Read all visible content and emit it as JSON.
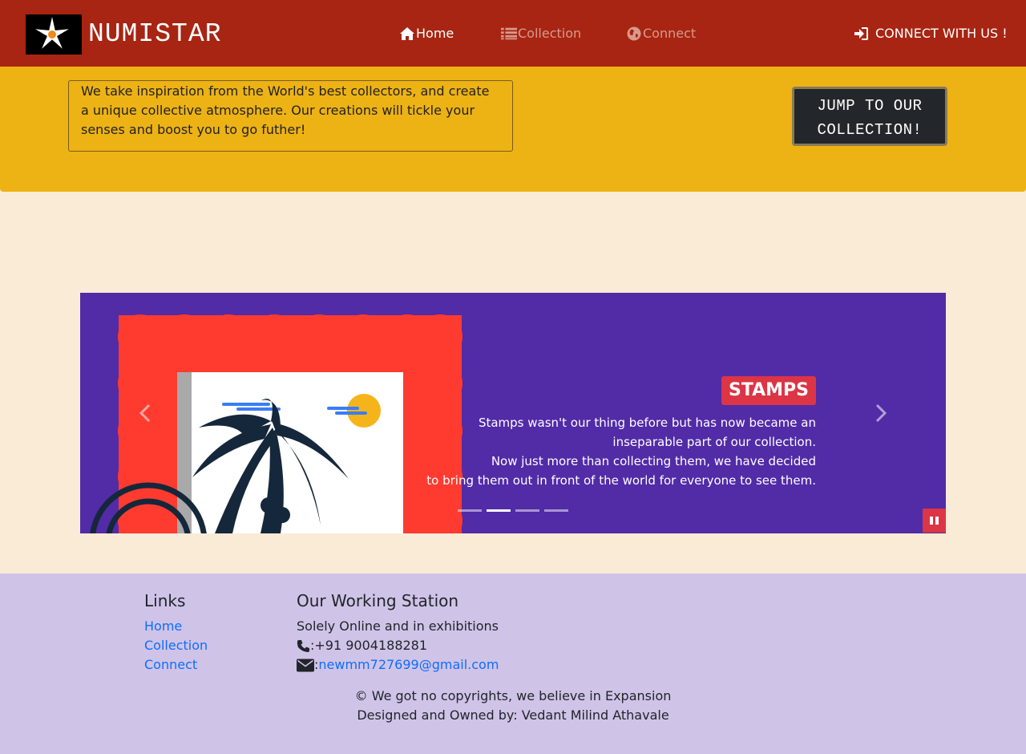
{
  "navbar": {
    "brand": "NUMISTAR",
    "links": [
      {
        "label": "Home",
        "icon": "home-icon",
        "color": "#ffffff"
      },
      {
        "label": "Collection",
        "icon": "list-icon",
        "color": "#d89a8c"
      },
      {
        "label": "Connect",
        "icon": "globe-icon",
        "color": "#d89a8c"
      }
    ],
    "cta": {
      "label": "CONNECT WITH US !",
      "icon": "sign-in-icon"
    },
    "background": "#a72512"
  },
  "hero": {
    "intro": "We take inspiration from the World's best collectors, and create a unique collective atmosphere. Our creations will tickle your senses and boost you to go futher!",
    "jump_button": "JUMP TO OUR COLLECTION!",
    "background": "#edb214"
  },
  "carousel": {
    "title": "STAMPS",
    "body_lines": [
      "Stamps wasn't our thing before but has now became an",
      "inseparable part of our collection.",
      "Now just more than collecting them, we have decided",
      "to bring them out in front of the world for everyone to see them."
    ],
    "slide_count": 4,
    "active_slide": 2,
    "background": "#522ba7"
  },
  "footer": {
    "links_title": "Links",
    "links": [
      "Home",
      "Collection",
      "Connect"
    ],
    "station_title": "Our Working Station",
    "station_text": "Solely Online and in exhibitions",
    "phone": ":+91 9004188281",
    "email_prefix": ":",
    "email": "newmm727699@gmail.com",
    "copyright": "© We got no copyrights, we believe in Expansion",
    "owner": "Designed and Owned by: Vedant Milind Athavale",
    "background": "#d0c3e8"
  }
}
